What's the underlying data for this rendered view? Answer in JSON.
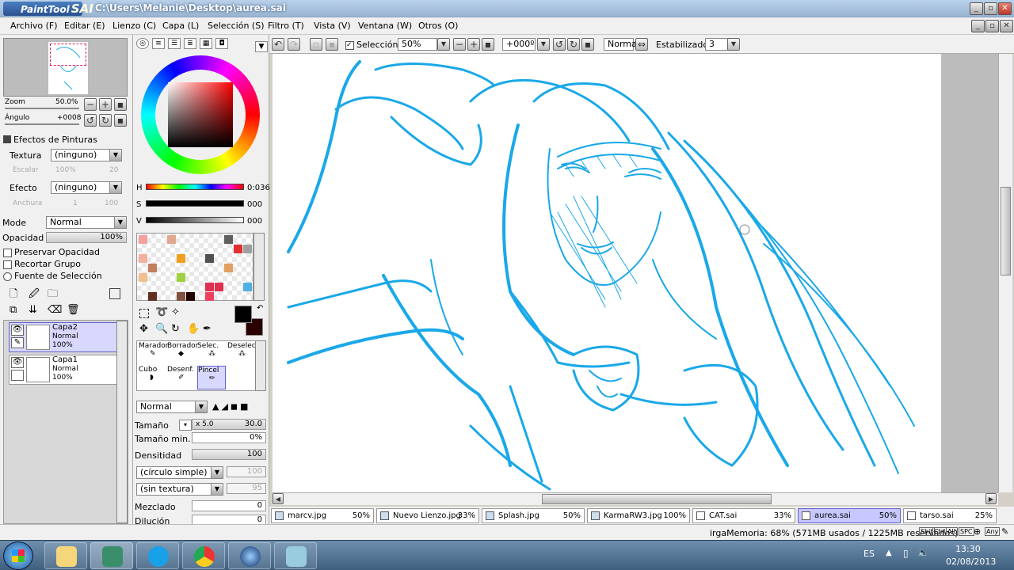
{
  "title": {
    "app_logo": "PaintTool",
    "app_logo_sai": "SAI",
    "path": "C:\\Users\\Melanie\\Desktop\\aurea.sai"
  },
  "menu": [
    "Archivo (F)",
    "Editar (E)",
    "Lienzo (C)",
    "Capa (L)",
    "Selección (S)",
    "Filtro (T)",
    "Vista (V)",
    "Ventana (W)",
    "Otros (O)"
  ],
  "navigator": {
    "zoom_label": "Zoom",
    "zoom_value": "50.0%",
    "angle_label": "Ángulo",
    "angle_value": "+0008"
  },
  "effects": {
    "header": "Efectos de Pinturas",
    "texture_label": "Textura",
    "texture_value": "(ninguno)",
    "scale_label": "Escalar",
    "scale_value": "100%",
    "scale_num": "20",
    "effect_label": "Efecto",
    "effect_value": "(ninguno)",
    "width_label": "Anchura",
    "width_value": "1",
    "width_num": "100"
  },
  "layer_props": {
    "mode_label": "Mode",
    "mode_value": "Normal",
    "opacity_label": "Opacidad",
    "opacity_value": "100%",
    "checks": [
      "Preservar Opacidad",
      "Recortar Grupo"
    ],
    "radio": "Fuente de Selección"
  },
  "layers": [
    {
      "name": "Capa2",
      "mode": "Normal",
      "opacity": "100%",
      "selected": true
    },
    {
      "name": "Capa1",
      "mode": "Normal",
      "opacity": "100%",
      "selected": false
    }
  ],
  "color": {
    "h_label": "H",
    "h_value": "0:036",
    "s_label": "S",
    "s_value": "000",
    "v_label": "V",
    "v_value": "000"
  },
  "tools_row1": [
    "Marador",
    "Borrador",
    "Selec.",
    "Deselec."
  ],
  "tools_row2": [
    "Cubo",
    "Desenf.",
    "Pincel"
  ],
  "brush": {
    "mode_value": "Normal",
    "size_label": "Tamaño",
    "size_mult": "x 5.0",
    "size_value": "30.0",
    "min_size_label": "Tamaño min.",
    "min_size_value": "0%",
    "density_label": "Densitidad",
    "density_value": "100",
    "shape_value": "(círculo simple)",
    "shape_num": "100",
    "texture_value": "(sin textura)",
    "texture_num": "95",
    "blend_label": "Mezclado",
    "blend_value": "0",
    "dilution_label": "Dilución",
    "dilution_value": "0"
  },
  "topbar": {
    "selection_label": "Selección",
    "zoom_value": "50%",
    "angle_value": "+000º",
    "blend_value": "Normal",
    "stabilizer_label": "Estabilizador",
    "stabilizer_value": "3"
  },
  "tabs": [
    {
      "name": "marcv.jpg",
      "pct": "50%"
    },
    {
      "name": "Nuevo Lienzo.jpg",
      "pct": "33%"
    },
    {
      "name": "Splash.jpg",
      "pct": "50%"
    },
    {
      "name": "KarmaRW3.jpg",
      "pct": "100%"
    },
    {
      "name": "CAT.sai",
      "pct": "33%"
    },
    {
      "name": "aurea.sai",
      "pct": "50%"
    },
    {
      "name": "tarso.sai",
      "pct": "25%"
    }
  ],
  "status": {
    "memory": "irgaMemoria: 68% (571MB usados / 1225MB reservados)",
    "keys": [
      "Shit",
      "Ctrl",
      "Alt",
      "SPC",
      "Any"
    ]
  },
  "taskbar": {
    "lang": "ES",
    "time": "13:30",
    "date": "02/08/2013"
  },
  "colors": {
    "accent": "#6060d0",
    "line": "#1aa8e8",
    "fg_swatch": "#000000",
    "bg_swatch": "#2a0000"
  }
}
